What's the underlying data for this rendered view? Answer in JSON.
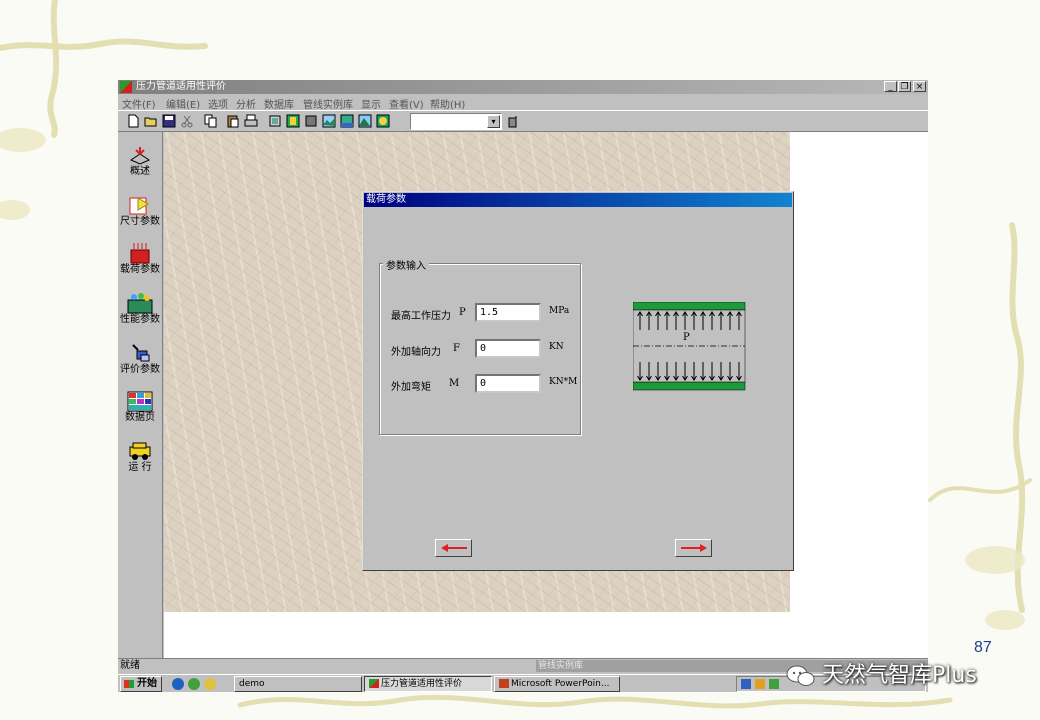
{
  "window": {
    "title": "压力管道适用性评价",
    "minimize": "_",
    "restore": "❐",
    "close": "×"
  },
  "menu": [
    "文件(F)",
    "编辑(E)",
    "选项",
    "分析",
    "数据库",
    "管线实例库",
    "显示",
    "查看(V)",
    "帮助(H)"
  ],
  "toolbar": {
    "combo_value": "",
    "combo_arrow": "▾"
  },
  "sidebar": [
    {
      "label": "概述",
      "icon": "overview-icon"
    },
    {
      "label": "尺寸参数",
      "icon": "size-params-icon"
    },
    {
      "label": "载荷参数",
      "icon": "load-params-icon"
    },
    {
      "label": "性能参数",
      "icon": "performance-params-icon"
    },
    {
      "label": "评价参数",
      "icon": "evaluation-params-icon"
    },
    {
      "label": "数据页",
      "icon": "data-page-icon"
    },
    {
      "label": "运  行",
      "icon": "run-icon"
    }
  ],
  "dialog": {
    "title": "载荷参数",
    "group_title": "参数输入",
    "fields": [
      {
        "label": "最高工作压力",
        "symbol": "P",
        "value": "1.5",
        "unit": "MPa"
      },
      {
        "label": "外加轴向力",
        "symbol": "F",
        "value": "0",
        "unit": "KN"
      },
      {
        "label": "外加弯矩",
        "symbol": "M",
        "value": "0",
        "unit": "KN*M"
      }
    ],
    "diagram_label": "P"
  },
  "statusbar": {
    "left": "就绪",
    "right": "管线实例库"
  },
  "taskbar": {
    "start": "开始",
    "tasks": [
      "demo",
      "压力管道适用性评价",
      "Microsoft PowerPoin..."
    ]
  },
  "slide": {
    "page_number": "87",
    "watermark": "天然气智库Plus"
  },
  "colors": {
    "title_active": "#000080",
    "title_inactive": "#808080",
    "face": "#c0c0c0",
    "pipe_wall": "#1e9a3a",
    "arrow_red": "#e02020"
  }
}
